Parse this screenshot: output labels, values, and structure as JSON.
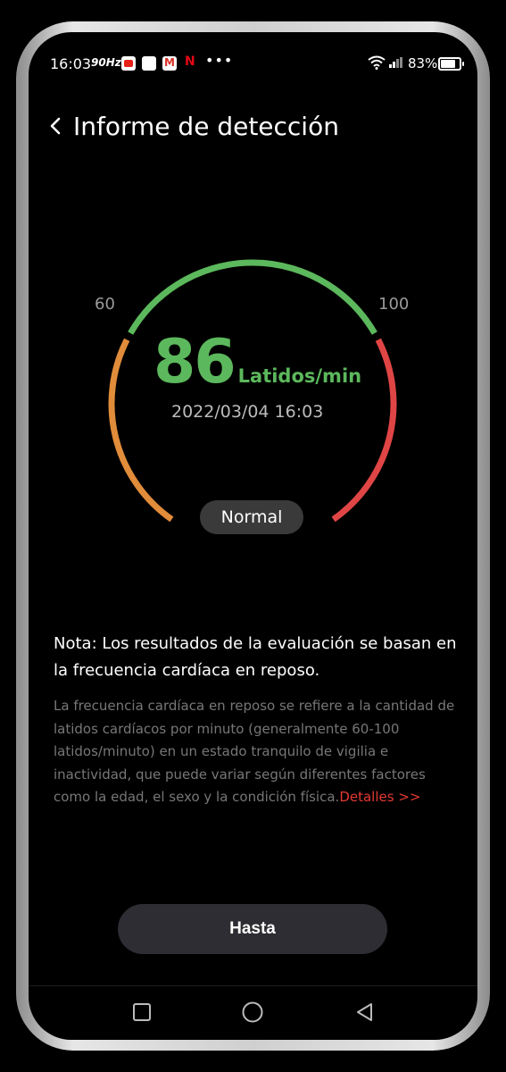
{
  "status_bar": {
    "time": "16:03",
    "refresh_rate": "90Hz",
    "battery": "83%",
    "app_icons": [
      "youtube-icon",
      "whatsapp-icon",
      "gmail-icon",
      "netflix-icon",
      "more-icon"
    ],
    "netflix_glyph": "N",
    "more_glyph": "•••"
  },
  "header": {
    "title": "Informe de detección",
    "back_icon": "chevron-left-icon"
  },
  "gauge": {
    "min_label": "60",
    "max_label": "100",
    "value": "86",
    "unit": "Latidos/min",
    "timestamp": "2022/03/04 16:03",
    "status": "Normal",
    "colors": {
      "low": "#e08c3a",
      "normal": "#5cb85c",
      "high": "#e04545",
      "value_text": "#5cb85c"
    }
  },
  "note": {
    "title": "Nota: Los resultados de la evaluación se basan en la frecuencia cardíaca en reposo.",
    "body": "La frecuencia cardíaca en reposo se refiere a la cantidad de latidos cardíacos por minuto (generalmente 60-100 latidos/minuto) en un estado tranquilo de vigilia e inactividad, que puede variar según diferentes factores como la edad, el sexo y la condición física.",
    "details_link": "Detalles >>",
    "link_color": "#e53935"
  },
  "primary_button": {
    "label": "Hasta"
  },
  "nav_bar": {
    "items": [
      "recents-square-icon",
      "home-circle-icon",
      "back-triangle-icon"
    ]
  }
}
